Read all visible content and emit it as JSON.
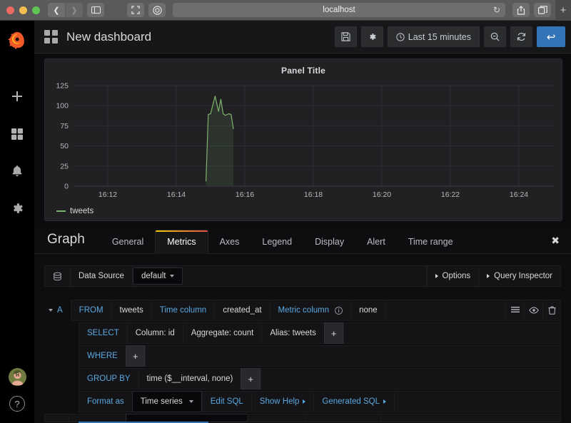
{
  "browser": {
    "url": "localhost",
    "back_icon": "chevron-left-icon",
    "forward_icon": "chevron-right-icon",
    "sidebar_icon": "sidebar-toggle-icon",
    "fullscreen_icon": "fullscreen-icon",
    "reader_icon": "reader-mode-icon",
    "reload_icon": "reload-icon",
    "share_icon": "share-icon",
    "tabs_icon": "tab-overview-icon",
    "newtab_label": "+"
  },
  "sidenav": {
    "logo": "grafana-logo-icon",
    "items": [
      {
        "name": "create",
        "icon": "plus-icon"
      },
      {
        "name": "dashboards",
        "icon": "dashboards-grid-icon"
      },
      {
        "name": "alerting",
        "icon": "bell-icon"
      },
      {
        "name": "configuration",
        "icon": "gear-icon"
      }
    ],
    "avatar": "user-avatar",
    "help_label": "?"
  },
  "header": {
    "title": "New dashboard",
    "grid_icon": "dashboard-grid-icon",
    "save_icon": "save-icon",
    "settings_icon": "gear-icon",
    "time_range": "Last 15 minutes",
    "time_icon": "clock-icon",
    "zoom_out_icon": "search-minus-icon",
    "refresh_icon": "refresh-icon",
    "back_label": "↩"
  },
  "panel": {
    "title": "Panel Title"
  },
  "chart_data": {
    "type": "area",
    "title": "Panel Title",
    "xlabel": "",
    "ylabel": "",
    "ylim": [
      0,
      125
    ],
    "yticks": [
      0,
      25,
      50,
      75,
      100,
      125
    ],
    "xticks": [
      "16:12",
      "16:14",
      "16:16",
      "16:18",
      "16:20",
      "16:22",
      "16:24"
    ],
    "xlim": [
      "16:11:00",
      "16:25:00"
    ],
    "grid": true,
    "legend_position": "bottom-left",
    "series": [
      {
        "name": "tweets",
        "color": "#7eb26d",
        "fill": true,
        "points": [
          {
            "x": "16:14:52",
            "y": 6
          },
          {
            "x": "16:14:56",
            "y": 89
          },
          {
            "x": "16:15:00",
            "y": 90
          },
          {
            "x": "16:15:04",
            "y": 101
          },
          {
            "x": "16:15:08",
            "y": 112
          },
          {
            "x": "16:15:12",
            "y": 99
          },
          {
            "x": "16:15:14",
            "y": 93
          },
          {
            "x": "16:15:18",
            "y": 108
          },
          {
            "x": "16:15:22",
            "y": 90
          },
          {
            "x": "16:15:26",
            "y": 88
          },
          {
            "x": "16:15:32",
            "y": 90
          },
          {
            "x": "16:15:36",
            "y": 89
          },
          {
            "x": "16:15:40",
            "y": 71
          }
        ]
      }
    ],
    "legend": [
      "tweets"
    ]
  },
  "editor": {
    "heading": "Graph",
    "tabs": [
      {
        "label": "General",
        "active": false
      },
      {
        "label": "Metrics",
        "active": true
      },
      {
        "label": "Axes",
        "active": false
      },
      {
        "label": "Legend",
        "active": false
      },
      {
        "label": "Display",
        "active": false
      },
      {
        "label": "Alert",
        "active": false
      },
      {
        "label": "Time range",
        "active": false
      }
    ],
    "close_label": "✖",
    "datasource": {
      "icon": "database-icon",
      "label": "Data Source",
      "value": "default",
      "options_label": "Options",
      "query_inspector_label": "Query Inspector"
    },
    "query": {
      "ref_id": "A",
      "from_label": "FROM",
      "from_table": "tweets",
      "time_column_label": "Time column",
      "time_column_value": "created_at",
      "metric_column_label": "Metric column",
      "metric_column_info": "i",
      "metric_column_value": "none",
      "select_label": "SELECT",
      "select_parts": [
        "Column: id",
        "Aggregate: count",
        "Alias: tweets"
      ],
      "where_label": "WHERE",
      "groupby_label": "GROUP BY",
      "groupby_parts": [
        "time ($__interval, none)"
      ],
      "add_label": "+",
      "format_label": "Format as",
      "format_value": "Time series",
      "edit_sql_label": "Edit SQL",
      "show_help_label": "Show Help",
      "generated_sql_label": "Generated SQL",
      "tools": [
        {
          "name": "query-menu",
          "icon": "hamburger-icon"
        },
        {
          "name": "query-toggle-visibility",
          "icon": "eye-icon"
        },
        {
          "name": "query-delete",
          "icon": "trash-icon"
        }
      ]
    }
  },
  "colors": {
    "accent_blue": "#3274b8",
    "series_green": "#7eb26d",
    "link_blue": "#5aa8e0",
    "tab_gradient_start": "#f2cc0c",
    "tab_gradient_end": "#e24d42"
  }
}
